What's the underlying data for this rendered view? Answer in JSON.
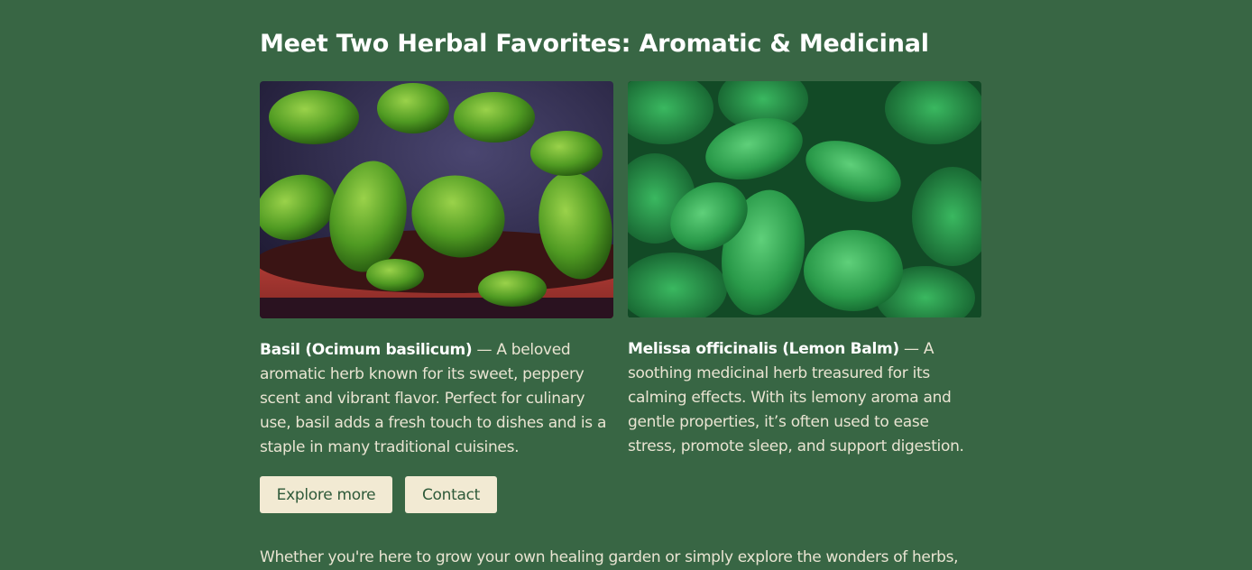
{
  "section": {
    "title": "Meet Two Herbal Favorites: Aromatic & Medicinal"
  },
  "cards": [
    {
      "name": "Basil (Ocimum basilicum)",
      "separator": " — ",
      "description": "A beloved aromatic herb known for its sweet, peppery scent and vibrant flavor. Perfect for culinary use, basil adds a fresh touch to dishes and is a staple in many traditional cuisines."
    },
    {
      "name": "Melissa officinalis (Lemon Balm)",
      "separator": " — ",
      "description": "A soothing medicinal herb treasured for its calming effects. With its lemony aroma and gentle properties, it’s often used to ease stress, promote sleep, and support digestion."
    }
  ],
  "buttons": {
    "explore_label": "Explore more",
    "contact_label": "Contact"
  },
  "footer": {
    "text": "Whether you're here to grow your own healing garden or simply explore the wonders of herbs,"
  },
  "colors": {
    "background": "#386644",
    "button_bg": "#f2ead3",
    "button_text": "#2f5a3a",
    "text": "#e9e4d2",
    "heading": "#ffffff"
  }
}
